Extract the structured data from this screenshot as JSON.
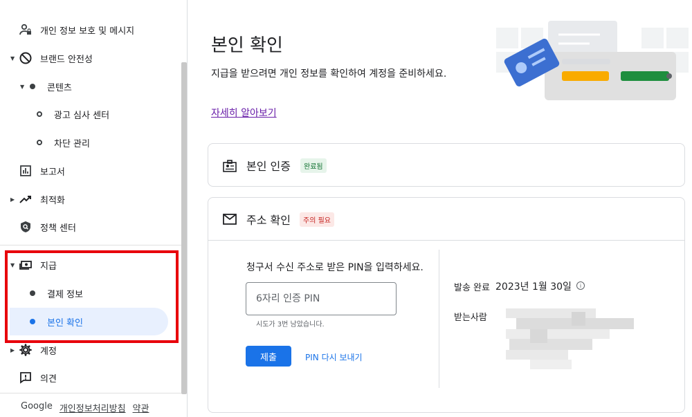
{
  "sidebar": {
    "items": [
      {
        "label": "개인 정보 보호 및 메시지",
        "icon": "privacy-person-icon"
      },
      {
        "label": "브랜드 안전성",
        "icon": "block-icon"
      },
      {
        "label": "콘텐츠"
      },
      {
        "label": "광고 심사 센터"
      },
      {
        "label": "차단 관리"
      },
      {
        "label": "보고서",
        "icon": "bar-chart-icon"
      },
      {
        "label": "최적화",
        "icon": "trending-up-icon"
      },
      {
        "label": "정책 센터",
        "icon": "shield-icon"
      },
      {
        "label": "지급",
        "icon": "payments-icon"
      },
      {
        "label": "결제 정보"
      },
      {
        "label": "본인 확인"
      },
      {
        "label": "계정",
        "icon": "gear-icon"
      },
      {
        "label": "의견",
        "icon": "feedback-icon"
      }
    ],
    "footer": {
      "brand": "Google",
      "privacy": "개인정보처리방침",
      "terms": "약관"
    }
  },
  "main": {
    "title": "본인 확인",
    "description": "지급을 받으려면 개인 정보를 확인하여 계정을 준비하세요.",
    "learn_more": "자세히 알아보기",
    "identity_card": {
      "title": "본인 인증",
      "status": "완료됨"
    },
    "address_card": {
      "title": "주소 확인",
      "status": "주의 필요",
      "prompt": "청구서 수신 주소로 받은 PIN을 입력하세요.",
      "pin_placeholder": "6자리 인증 PIN",
      "attempts_hint": "시도가 3번 남았습니다.",
      "submit_label": "제출",
      "resend_label": "PIN 다시 보내기",
      "sent_label": "발송 완료",
      "sent_date": "2023년 1월 30일",
      "recipient_label": "받는사람"
    }
  },
  "colors": {
    "accent": "#1a73e8",
    "highlight": "#e8000b",
    "success_bg": "#e6f4ea",
    "warn_bg": "#fce8e6"
  }
}
